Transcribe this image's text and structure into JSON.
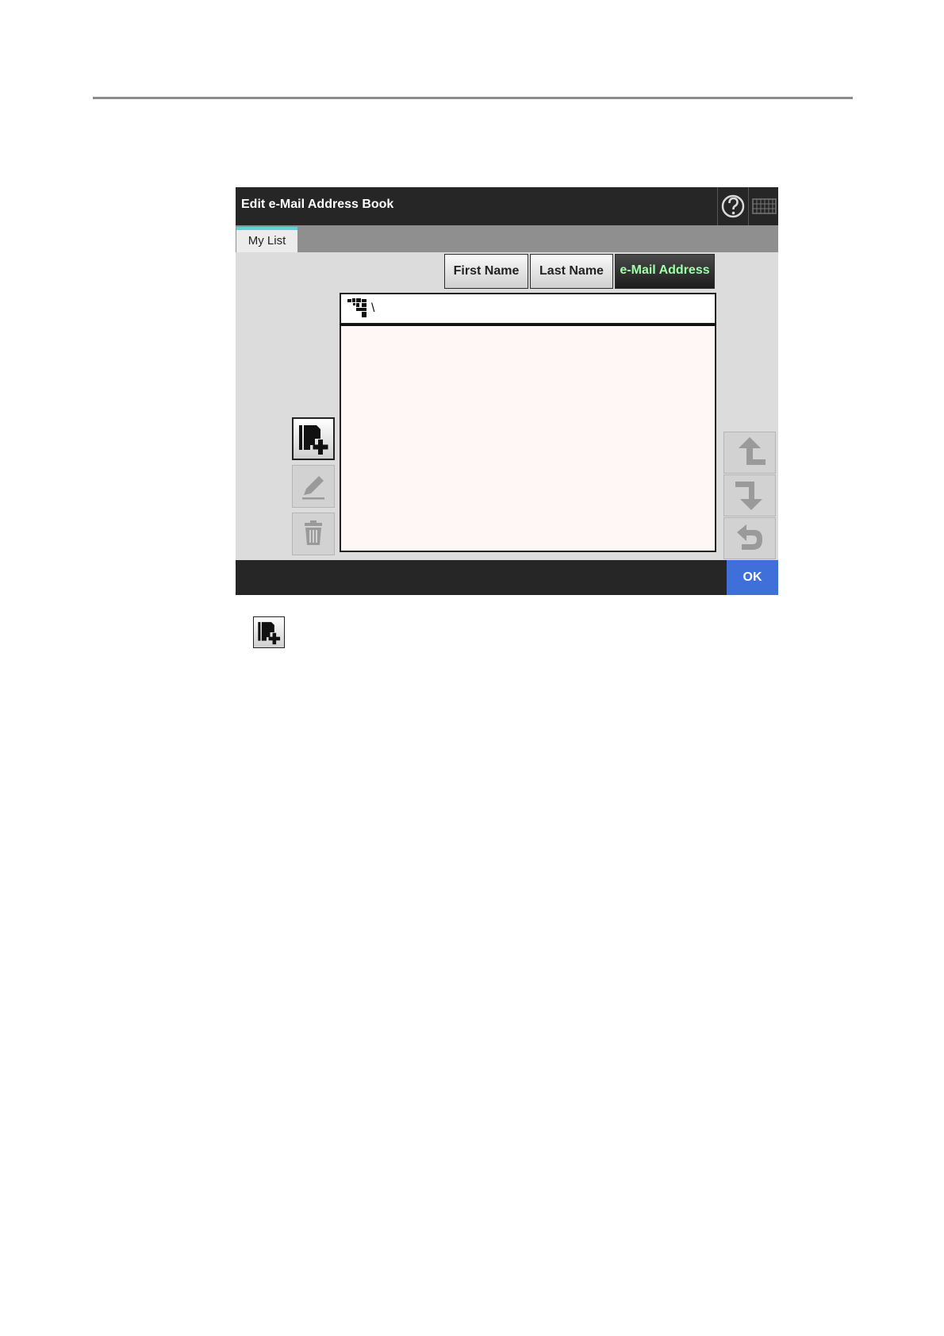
{
  "dialog": {
    "title": "Edit e-Mail Address Book",
    "tabs": [
      {
        "label": "My List",
        "active": true
      }
    ],
    "sort_buttons": [
      {
        "label": "First Name",
        "active": false
      },
      {
        "label": "Last Name",
        "active": false
      },
      {
        "label": "e-Mail Address",
        "active": true
      }
    ],
    "path": "\\",
    "ok_label": "OK",
    "icons": {
      "help": "help-icon",
      "keyboard": "keyboard-icon",
      "add": "add-entry-icon",
      "edit": "pencil-icon",
      "delete": "trash-icon",
      "up": "move-up-icon",
      "down": "move-down-icon",
      "back": "return-icon",
      "folder": "group-folder-icon"
    },
    "colors": {
      "titlebar": "#262626",
      "tab_accent": "#5fd3d8",
      "active_sort_text": "#9dffa8",
      "ok_button": "#3f6fd8",
      "list_background": "#fff6f6"
    }
  },
  "legend": {
    "icon": "add-entry-icon"
  }
}
